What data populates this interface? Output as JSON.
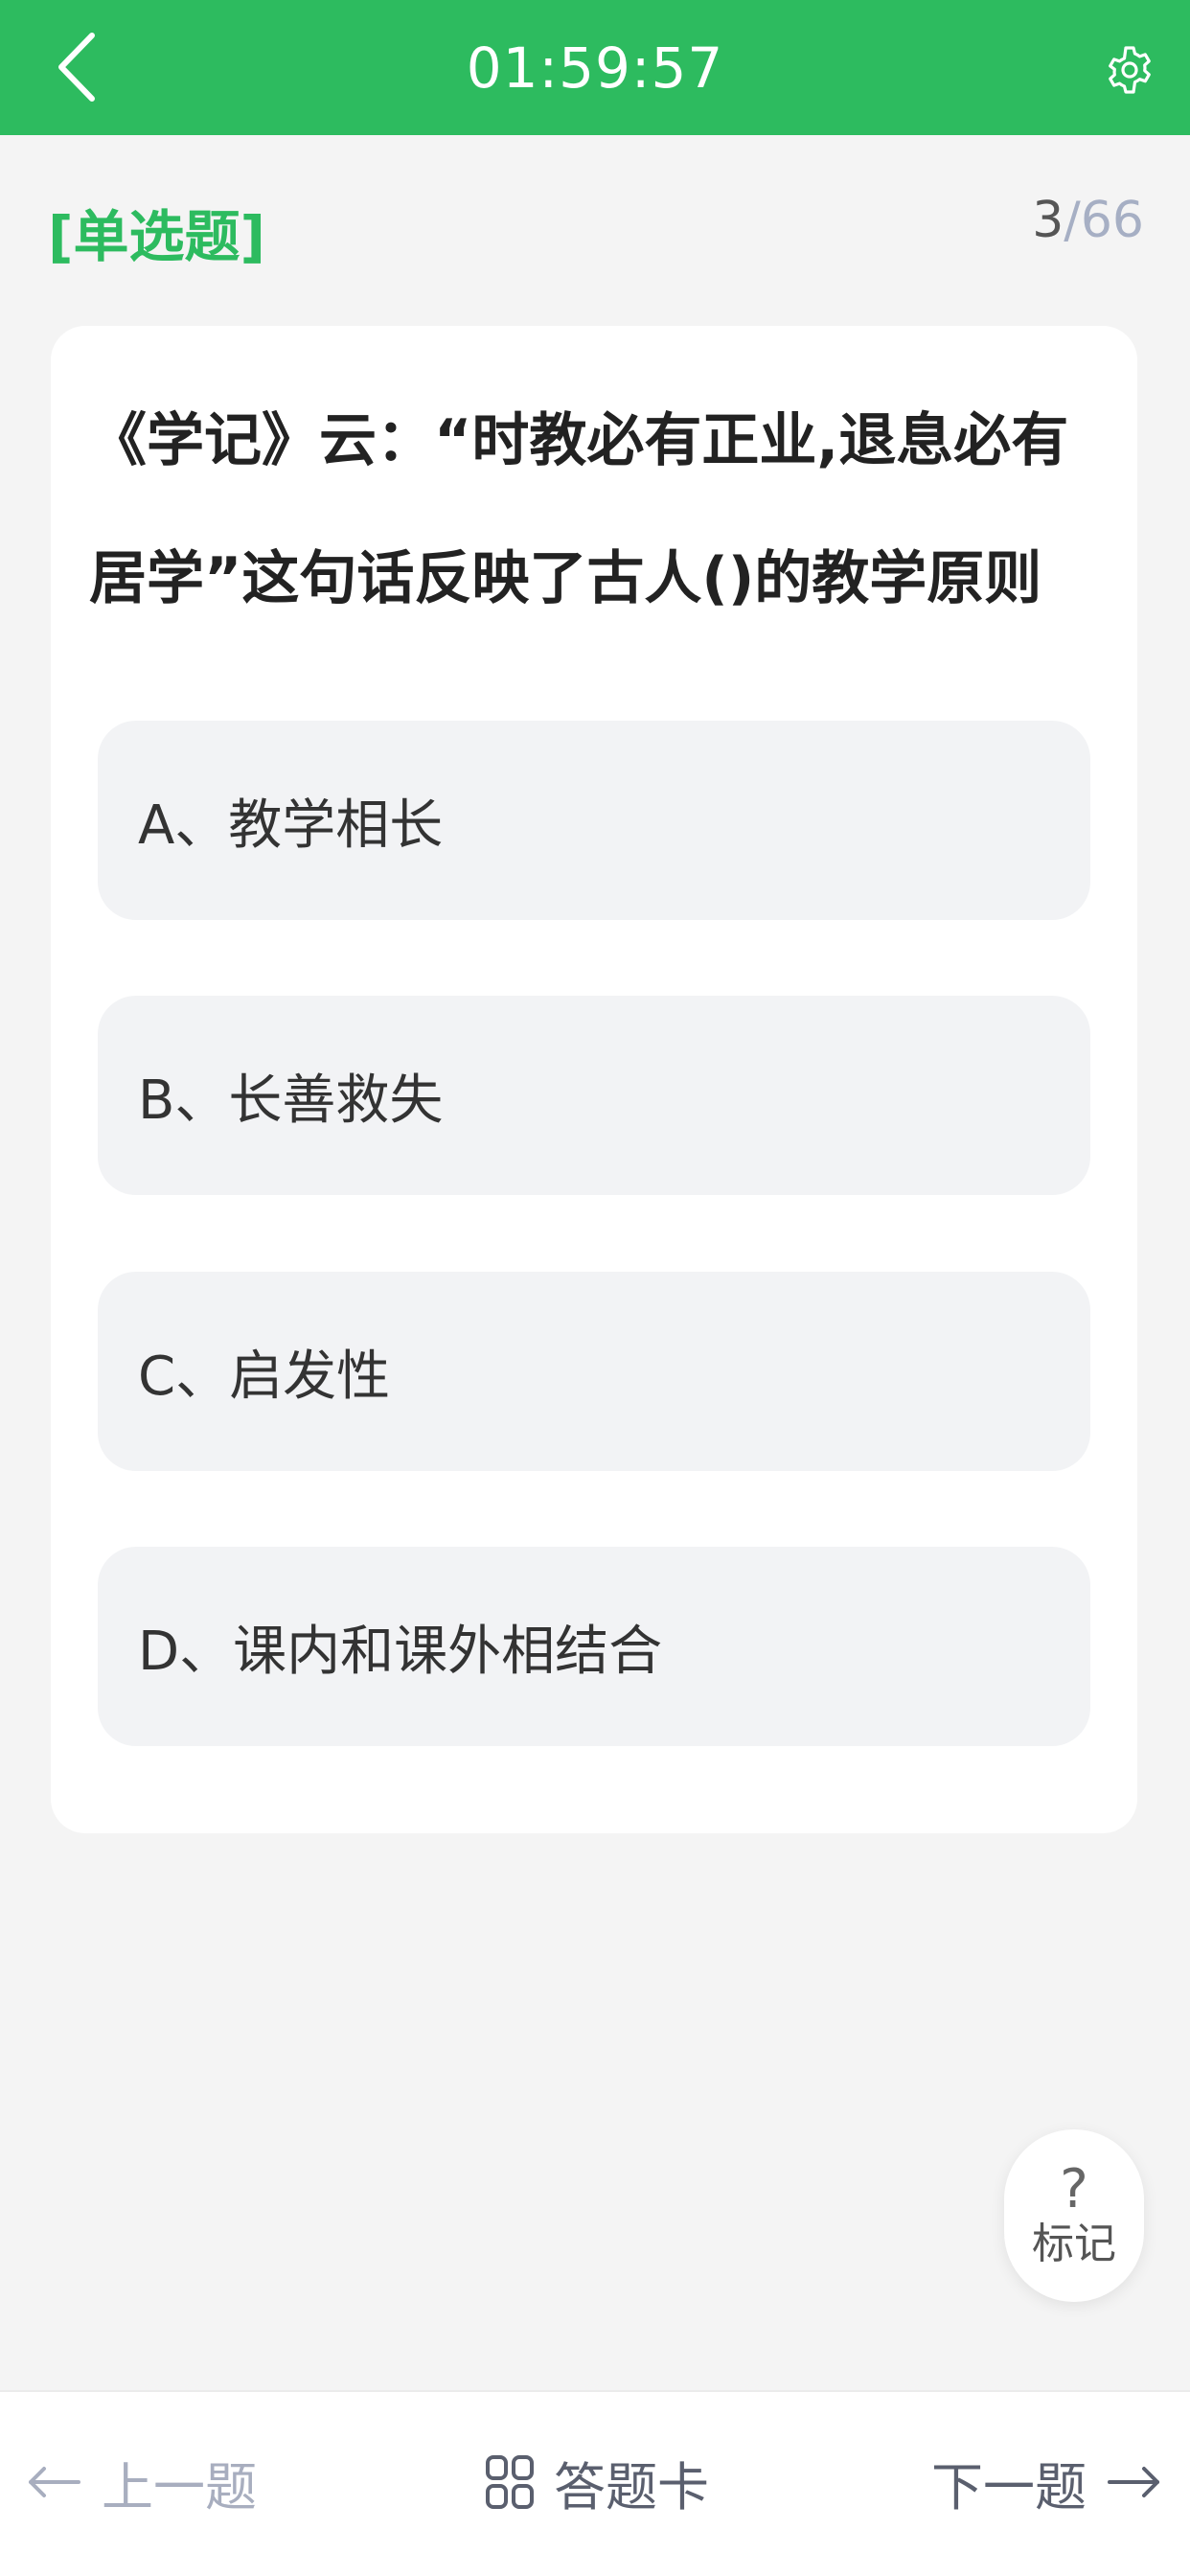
{
  "header": {
    "timer": "01:59:57",
    "back_icon": "chevron-left-icon",
    "settings_icon": "gear-icon"
  },
  "question_type": "[单选题]",
  "progress": {
    "current": "3",
    "separator": "/",
    "total": "66"
  },
  "question": {
    "text": "《学记》云：“时教必有正业,退息必有居学”这句话反映了古人()的教学原则",
    "options": [
      {
        "label": "A、教学相长"
      },
      {
        "label": "B、长善救失"
      },
      {
        "label": "C、启发性"
      },
      {
        "label": "D、课内和课外相结合"
      }
    ]
  },
  "mark": {
    "icon_text": "?",
    "label": "标记"
  },
  "footer": {
    "prev_label": "上一题",
    "card_label": "答题卡",
    "next_label": "下一题"
  },
  "colors": {
    "brand_green": "#2dbb5f",
    "background": "#f4f4f4"
  }
}
